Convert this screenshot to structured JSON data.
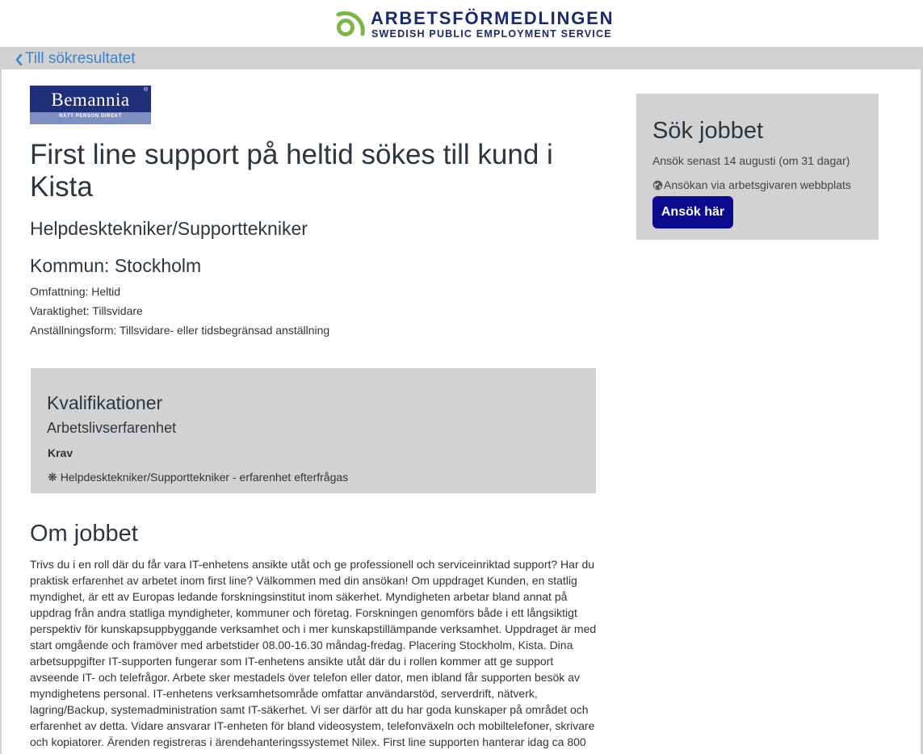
{
  "header": {
    "brand_name": "ARBETSFÖRMEDLINGEN",
    "brand_tagline": "SWEDISH PUBLIC EMPLOYMENT SERVICE",
    "logo_icon": "arbetsformedlingen-logo-icon",
    "brand_colors": {
      "green": "#7ab648",
      "navy": "#1b2a6b"
    }
  },
  "nav": {
    "back_label": "Till sökresultatet"
  },
  "company": {
    "logo_name": "Bemannia",
    "logo_tagline": "RÄTT PERSON DIREKT",
    "logo_registered": "®"
  },
  "job": {
    "title": "First line support på heltid sökes till kund i Kista",
    "occupation": "Helpdesktekniker/Supporttekniker",
    "municipality": "Kommun: Stockholm",
    "extent": "Omfattning: Heltid",
    "duration": "Varaktighet: Tillsvidare",
    "employment_type": "Anställningsform: Tillsvidare- eller tidsbegränsad anställning"
  },
  "qualifications": {
    "title": "Kvalifikationer",
    "subtitle": "Arbetslivserfarenhet",
    "requirement_label": "Krav",
    "items": [
      {
        "bullet": "❋",
        "text": "Helpdesktekniker/Supporttekniker - erfarenhet efterfrågas"
      }
    ]
  },
  "about": {
    "title": "Om jobbet",
    "body": "Trivs du i en roll där du får vara IT-enhetens ansikte utåt och ge professionell och serviceinriktad support? Har du praktisk erfarenhet av arbetet inom first line? Välkommen med din ansökan! Om uppdraget Kunden, en statlig myndighet, är ett av Europas ledande forskningsinstitut inom säkerhet. Myndigheten arbetar bland annat på uppdrag från andra statliga myndigheter, kommuner och företag. Forskningen genomförs både i ett långsiktigt perspektiv för kunskapsuppbyggande verksamhet och i mer kunskapstillämpande verksamhet. Uppdraget är med start omgående och framöver med arbetstider 08.00-16.30 måndag-fredag. Placering Stockholm, Kista. Dina arbetsuppgifter IT-supporten fungerar som IT-enhetens ansikte utåt där du i rollen kommer att ge support avseende IT- och telefrågor. Arbete sker mestadels över telefon eller dator, men ibland får supporten besök av myndighetens personal. IT-enhetens verksamhetsområde omfattar användarstöd, serverdrift, nätverk, lagring/Backup, systemadministration samt IT-säkerhet. Vi ser därför att du har goda kunskaper på området och erfarenhet av detta. Vidare ansvarar IT-enheten för bland videosystem, telefonväxeln och mobiltelefoner, skrivare och kopiatorer. Ärenden registreras i ärendehanteringssystemet Nilex. First line supporten hanterar idag ca 800"
  },
  "apply": {
    "title": "Sök jobbet",
    "deadline": "Ansök senast 14 augusti (om 31 dagar)",
    "via": "Ansökan via arbetsgivaren webbplats",
    "via_icon": "globe-icon",
    "button_label": "Ansök här",
    "button_color": "#0a0a8c"
  }
}
